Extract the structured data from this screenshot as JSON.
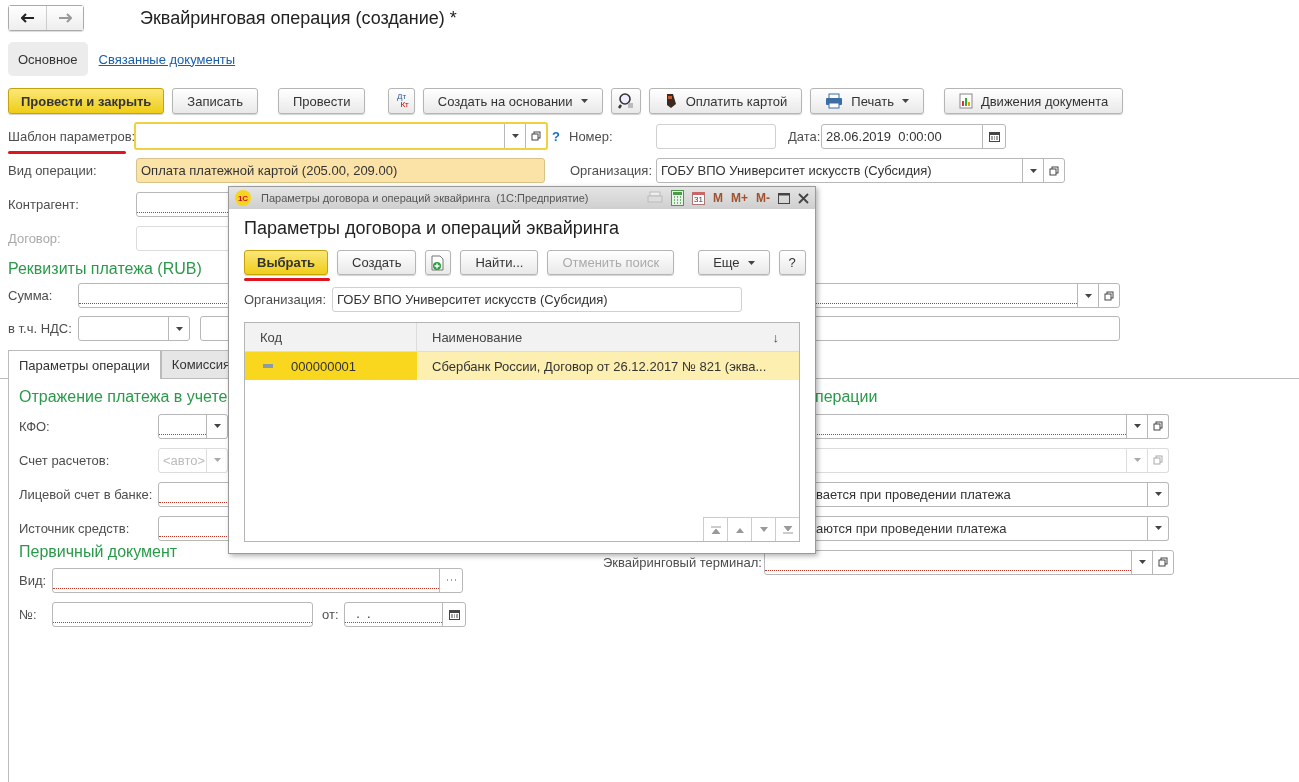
{
  "nav": {
    "back": {
      "disabled": false
    },
    "forward": {
      "disabled": true
    }
  },
  "title": "Эквайринговая операция (создание) *",
  "sections": [
    {
      "label": "Основное",
      "selected": true
    },
    {
      "label": "Связанные документы",
      "selected": false
    }
  ],
  "toolbar": [
    {
      "kind": "primary",
      "label": "Провести и закрыть",
      "menu": false
    },
    {
      "kind": "plain",
      "label": "Записать",
      "menu": false
    },
    {
      "kind": "plain",
      "label": "Провести",
      "menu": false
    },
    {
      "kind": "dtkt",
      "label": "Дт",
      "sublabel": "Кт",
      "menu": false
    },
    {
      "kind": "plain",
      "label": "Создать на основании",
      "menu": true
    },
    {
      "kind": "search",
      "menu": false
    },
    {
      "kind": "card",
      "label": "Оплатить картой",
      "menu": false
    },
    {
      "kind": "print",
      "label": "Печать",
      "menu": true
    },
    {
      "kind": "report",
      "label": "Движения документа",
      "menu": false
    }
  ],
  "template": {
    "label": "Шаблон параметров:",
    "help": "?",
    "focused": true
  },
  "number": {
    "label": "Номер:"
  },
  "date": {
    "label": "Дата:",
    "value": "28.06.2019  0:00:00"
  },
  "operation_type": {
    "label": "Вид операции:",
    "value": "Оплата платежной картой (205.00, 209.00)"
  },
  "organization": {
    "label": "Организация:",
    "value": "ГОБУ ВПО Университет искусств (Субсидия)"
  },
  "counterparty": {
    "label": "Контрагент:",
    "required": true
  },
  "contract": {
    "label": "Договор:",
    "disabled": true
  },
  "payment": {
    "title": "Реквизиты платежа (RUB)",
    "amount": {
      "label": "Сумма:",
      "required": true
    },
    "vat": {
      "label": "в т.ч. НДС:"
    }
  },
  "tabs": [
    {
      "label": "Параметры операции",
      "selected": true
    },
    {
      "label": "Комиссия",
      "selected": false
    }
  ],
  "accounting": {
    "title": "Отражение платежа в учете",
    "fields": [
      {
        "label": "КФО:",
        "kind": "choice",
        "required": true,
        "disabled": false
      },
      {
        "label": "Счет расчетов:",
        "kind": "choice",
        "placeholder": "<авто>",
        "required": false,
        "disabled": true
      },
      {
        "label": "Лицевой счет в банке:",
        "kind": "input",
        "required": true,
        "disabled": false
      },
      {
        "label": "Источник средств:",
        "kind": "input",
        "required": true,
        "disabled": false
      }
    ]
  },
  "operation_params": {
    "title": "перации",
    "fields": [
      {
        "kind": "reference",
        "required": true,
        "disabled": false
      },
      {
        "kind": "reference",
        "required": false,
        "disabled": true
      },
      {
        "kind": "choice",
        "value": "вается при проведении платежа",
        "required": false,
        "disabled": false
      },
      {
        "kind": "choice",
        "value": "аются при проведении платежа",
        "required": false,
        "disabled": false
      },
      {
        "kind": "reference",
        "label": "Эквайринговый терминал:",
        "required": true,
        "disabled": false
      }
    ]
  },
  "primary_document": {
    "title": "Первичный документ",
    "type": {
      "label": "Вид:",
      "required": true
    },
    "number": {
      "label": "№:",
      "required": true
    },
    "date": {
      "label": "от:",
      "value": "  .  .",
      "required": true
    }
  },
  "dialog": {
    "logo": "1С",
    "window_title": "Параметры договора и операций эквайринга  (1С:Предприятие)",
    "calendar_day": "31",
    "memory": [
      "M",
      "M+",
      "M-"
    ],
    "heading": "Параметры договора и операций эквайринга",
    "buttons": [
      {
        "kind": "primary",
        "label": "Выбрать",
        "disabled": false,
        "menu": false
      },
      {
        "kind": "plain",
        "label": "Создать",
        "disabled": false,
        "menu": false
      },
      {
        "kind": "add",
        "disabled": false,
        "menu": false
      },
      {
        "kind": "plain",
        "label": "Найти...",
        "disabled": false,
        "menu": false
      },
      {
        "kind": "plain",
        "label": "Отменить поиск",
        "disabled": true,
        "menu": false
      },
      {
        "kind": "plain",
        "label": "Еще",
        "disabled": false,
        "menu": true
      },
      {
        "kind": "plain",
        "label": "?",
        "disabled": false,
        "menu": false
      }
    ],
    "organization": {
      "label": "Организация:",
      "value": "ГОБУ ВПО Университет искусств (Субсидия)"
    },
    "table": {
      "columns": [
        "Код",
        "Наименование"
      ],
      "sort_mark": "↓",
      "rows": [
        {
          "code": "000000001",
          "name": "Сбербанк России, Договор от 26.12.2017 № 821 (эква...",
          "selected": true
        }
      ]
    }
  }
}
